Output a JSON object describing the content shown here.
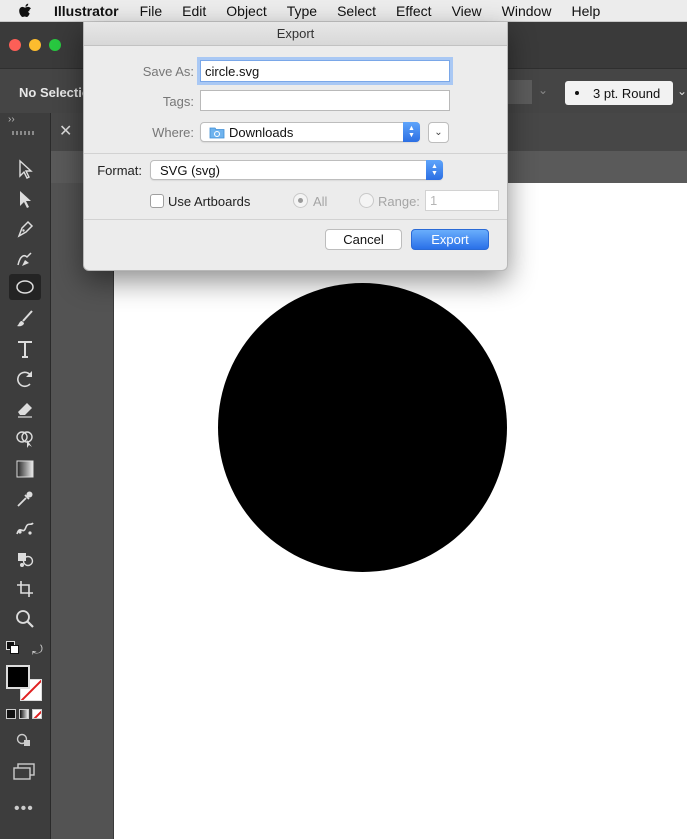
{
  "menubar": {
    "app_name": "Illustrator",
    "items": [
      "File",
      "Edit",
      "Object",
      "Type",
      "Select",
      "Effect",
      "View",
      "Window",
      "Help"
    ]
  },
  "control_bar": {
    "selection_label": "No Selectio",
    "stroke_profile": "3 pt. Round"
  },
  "dialog": {
    "title": "Export",
    "save_as_label": "Save As:",
    "save_as_value": "circle.svg",
    "tags_label": "Tags:",
    "tags_value": "",
    "where_label": "Where:",
    "where_value": "Downloads",
    "format_label": "Format:",
    "format_value": "SVG (svg)",
    "use_artboards_label": "Use Artboards",
    "use_artboards_checked": false,
    "all_label": "All",
    "range_label": "Range:",
    "range_value": "1",
    "cancel_label": "Cancel",
    "export_label": "Export"
  },
  "tools": [
    "selection-tool",
    "direct-selection-tool",
    "pen-tool",
    "curvature-tool",
    "ellipse-tool",
    "paintbrush-tool",
    "type-tool",
    "rotate-tool",
    "eraser-tool",
    "shape-builder-tool",
    "gradient-tool",
    "eyedropper-tool",
    "blend-tool",
    "symbol-sprayer-tool",
    "artboard-tool",
    "zoom-tool"
  ],
  "active_tool": "ellipse-tool",
  "colors": {
    "fill": "#000000",
    "stroke": "none",
    "accent": "#2a70e8",
    "artwork_circle": "#000000"
  }
}
